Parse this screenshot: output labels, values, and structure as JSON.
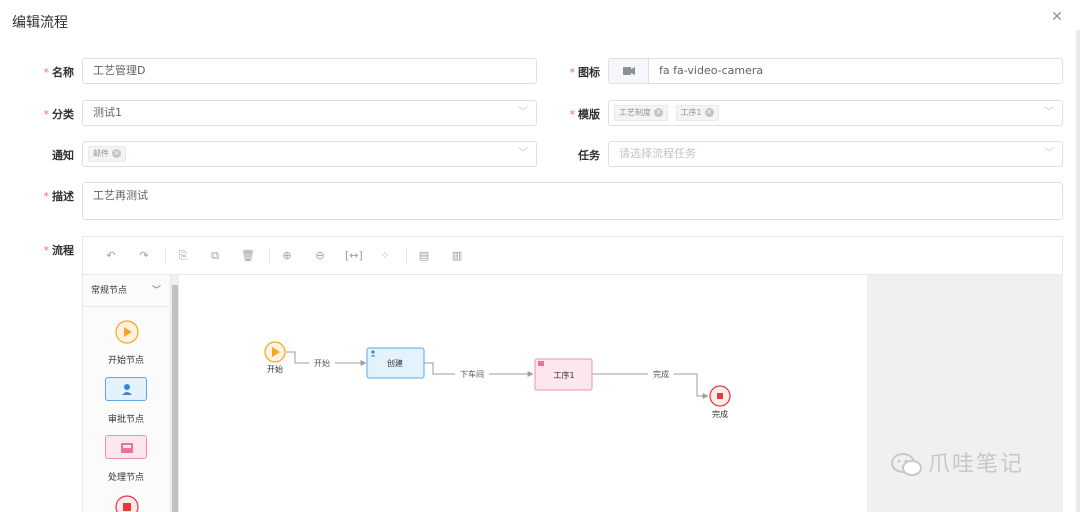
{
  "dialog": {
    "title": "编辑流程",
    "close_icon": "close-icon"
  },
  "form": {
    "name": {
      "label": "名称",
      "value": "工艺管理D"
    },
    "icon": {
      "label": "图标",
      "value": "fa fa-video-camera",
      "icon": "video-camera-icon"
    },
    "category": {
      "label": "分类",
      "value": "测试1"
    },
    "template": {
      "label": "模版",
      "tags": [
        "工艺制度",
        "工序1"
      ]
    },
    "notify": {
      "label": "通知",
      "tags": [
        "邮件"
      ]
    },
    "task": {
      "label": "任务",
      "placeholder": "请选择流程任务"
    },
    "description": {
      "label": "描述",
      "value": "工艺再测试"
    },
    "flow": {
      "label": "流程"
    }
  },
  "toolbar": {
    "items": [
      "undo-icon",
      "redo-icon",
      "copy-icon",
      "paste-icon",
      "delete-icon",
      "zoom-in-icon",
      "zoom-out-icon",
      "fit-icon",
      "actual-size-icon",
      "to-front-icon",
      "to-back-icon"
    ]
  },
  "palette": {
    "header": "常规节点",
    "items": [
      {
        "label": "开始节点",
        "icon": "play-icon"
      },
      {
        "label": "审批节点",
        "icon": "user-icon"
      },
      {
        "label": "处理节点",
        "icon": "inbox-icon"
      }
    ]
  },
  "diagram": {
    "nodes": {
      "start": "开始",
      "create": "创建",
      "step": "工序1",
      "end": "完成"
    },
    "edges": {
      "e1": "开始",
      "e2": "下车间",
      "e3": "完成"
    }
  },
  "watermark": "爪哇笔记",
  "colors": {
    "required": "#f56c6c",
    "start": "#f5a623",
    "approve": "#5aa9e6",
    "process": "#f48fb1",
    "end": "#e53935"
  }
}
